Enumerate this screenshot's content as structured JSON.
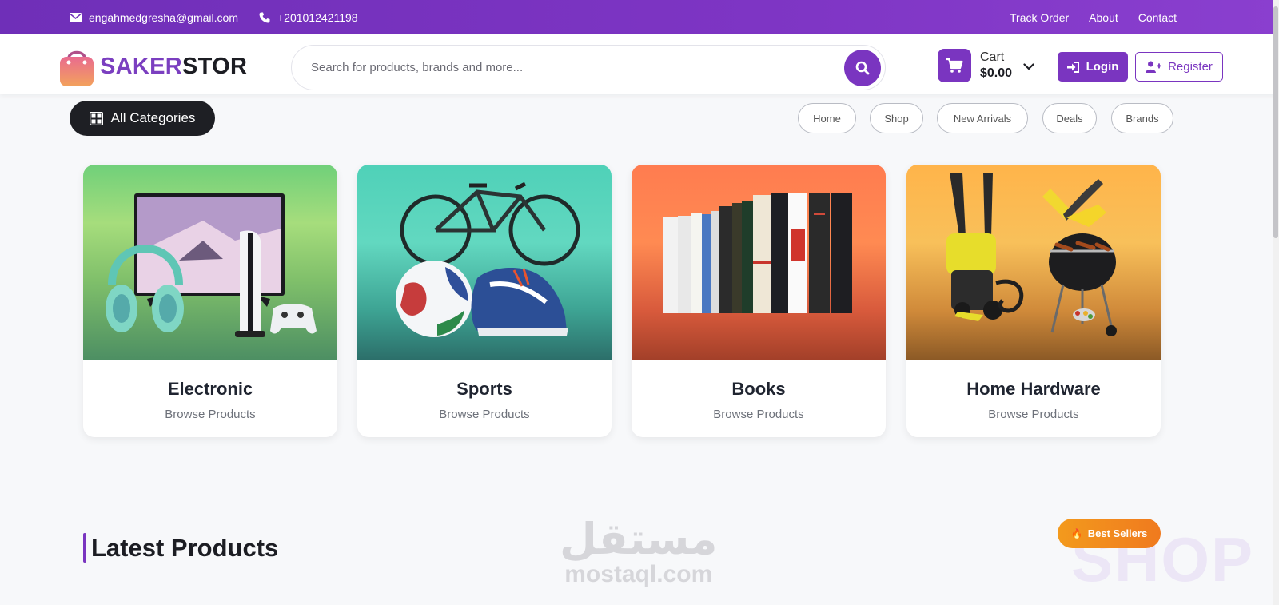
{
  "topbar": {
    "email": "engahmedgresha@gmail.com",
    "phone": "+201012421198",
    "links": [
      "Track Order",
      "About",
      "Contact"
    ]
  },
  "header": {
    "logo_part1": "SAKER",
    "logo_part2": "STOR",
    "search_placeholder": "Search for products, brands and more...",
    "cart_label": "Cart",
    "cart_total": "$0.00",
    "login_label": "Login",
    "register_label": "Register"
  },
  "nav": {
    "all_categories": "All Categories",
    "links": [
      "Home",
      "Shop",
      "New Arrivals",
      "Deals",
      "Brands"
    ]
  },
  "categories": [
    {
      "title": "Electronic",
      "subtitle": "Browse Products"
    },
    {
      "title": "Sports",
      "subtitle": "Browse Products"
    },
    {
      "title": "Books",
      "subtitle": "Browse Products"
    },
    {
      "title": "Home Hardware",
      "subtitle": "Browse Products"
    }
  ],
  "latest": {
    "title": "Latest Products",
    "badge": "Best Sellers",
    "watermark": "SHOP"
  },
  "overlay": {
    "mostaql_ar": "مستقل",
    "mostaql_en": "mostaql.com"
  },
  "colors": {
    "primary": "#7a35c0",
    "topbar": "#7233bb",
    "dark": "#1e1f24",
    "accent_orange": "#f39a1d"
  }
}
